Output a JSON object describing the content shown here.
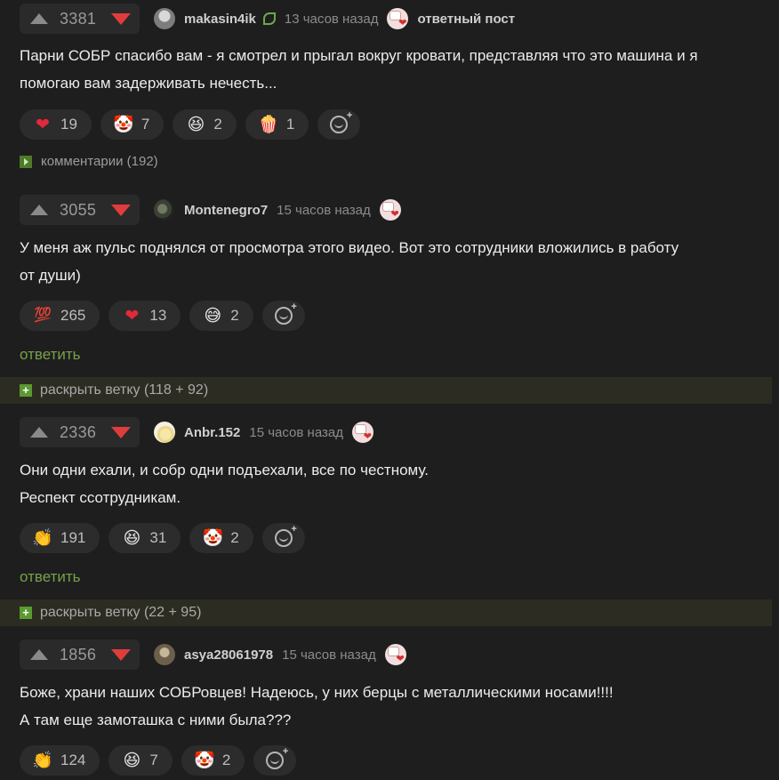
{
  "comments": [
    {
      "score": "3381",
      "username": "makasin4ik",
      "time": "13 часов назад",
      "reply_post_label": "ответный пост",
      "lines": [
        "Парни СОБР спасибо вам - я смотрел и прыгал вокруг кровати, представляя что это машина и я",
        "помогаю вам задерживать нечесть..."
      ],
      "reactions": [
        {
          "icon": "heart-icon",
          "glyph": "❤",
          "count": "19"
        },
        {
          "icon": "clown-icon",
          "glyph": "🤡",
          "count": "7"
        },
        {
          "icon": "laughing-icon",
          "glyph": "😆",
          "count": "2"
        },
        {
          "icon": "popcorn-icon",
          "glyph": "🍿",
          "count": "1"
        }
      ],
      "comments_link": "комментарии (192)"
    },
    {
      "score": "3055",
      "username": "Montenegro7",
      "time": "15 часов назад",
      "lines": [
        "У меня аж пульс поднялся от просмотра этого видео. Вот это сотрудники вложились в работу",
        "от души)"
      ],
      "reactions": [
        {
          "icon": "hundred-icon",
          "glyph": "💯",
          "count": "265"
        },
        {
          "icon": "heart-icon",
          "glyph": "❤",
          "count": "13"
        },
        {
          "icon": "sweat-smile-icon",
          "glyph": "😅",
          "count": "2"
        }
      ],
      "reply_label": "ответить",
      "branch_label": "раскрыть ветку (118 + 92)"
    },
    {
      "score": "2336",
      "username": "Anbr.152",
      "time": "15 часов назад",
      "lines": [
        "Они одни ехали, и собр одни подъехали, все по честному.",
        "Респект ссотрудникам."
      ],
      "reactions": [
        {
          "icon": "clapping-icon",
          "glyph": "👏",
          "count": "191"
        },
        {
          "icon": "laughing-icon",
          "glyph": "😆",
          "count": "31"
        },
        {
          "icon": "clown-icon",
          "glyph": "🤡",
          "count": "2"
        }
      ],
      "reply_label": "ответить",
      "branch_label": "раскрыть ветку (22 + 95)"
    },
    {
      "score": "1856",
      "username": "asya28061978",
      "time": "15 часов назад",
      "lines": [
        "Боже, храни наших СОБРовцев! Надеюсь, у них берцы с металлическими носами!!!!",
        "А там еще замоташка с ними была???"
      ],
      "reactions": [
        {
          "icon": "clapping-icon",
          "glyph": "👏",
          "count": "124"
        },
        {
          "icon": "laughing-icon",
          "glyph": "😆",
          "count": "7"
        },
        {
          "icon": "clown-icon",
          "glyph": "🤡",
          "count": "2"
        }
      ]
    }
  ],
  "colors": {
    "background": "#1e1e1e",
    "downvote": "#e03c3c",
    "reply_link": "#77a14b",
    "branch_bg": "#2c2c22"
  }
}
